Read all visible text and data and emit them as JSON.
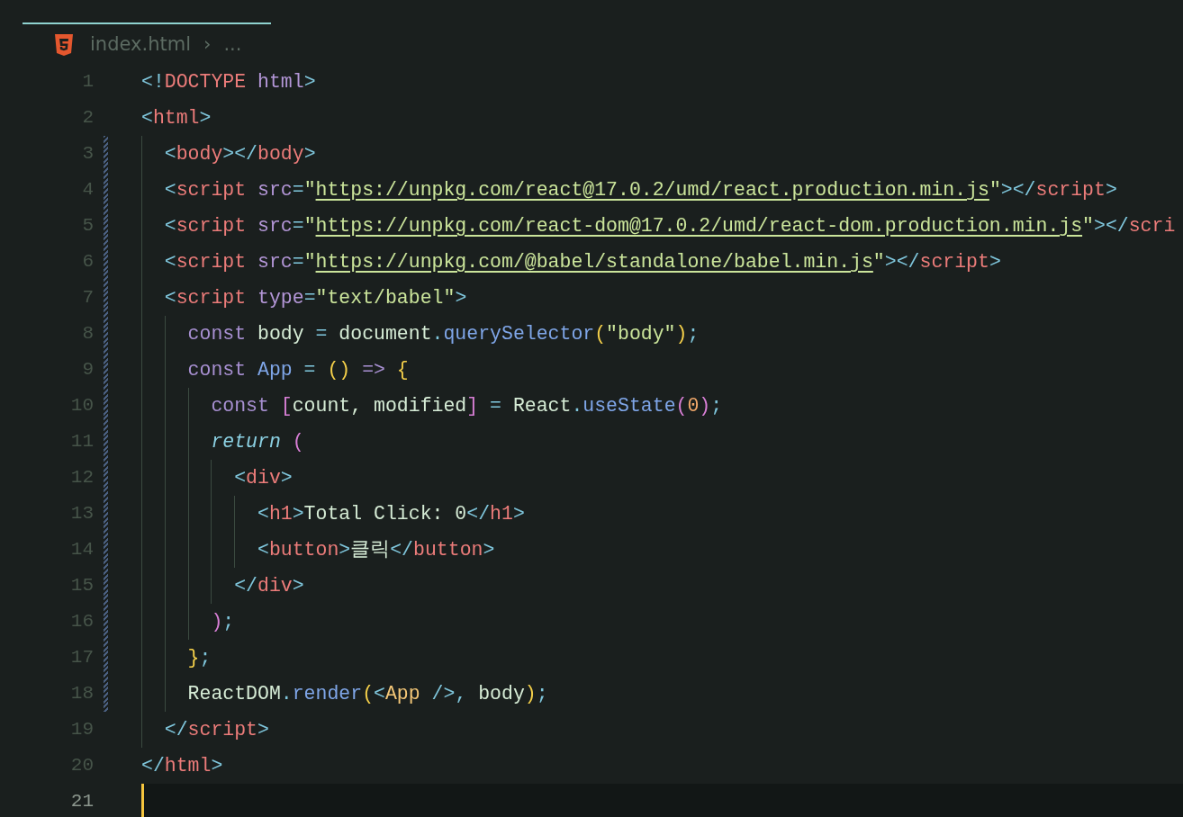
{
  "breadcrumb": {
    "file": "index.html",
    "separator": "›",
    "more": "..."
  },
  "lines": [
    {
      "number": "1",
      "modified": false,
      "current": false,
      "tokens": [
        {
          "kind": "punct",
          "text": "<!"
        },
        {
          "kind": "tag",
          "text": "DOCTYPE"
        },
        {
          "kind": "attr",
          "text": " html"
        },
        {
          "kind": "punct",
          "text": ">"
        }
      ]
    },
    {
      "number": "2",
      "modified": false,
      "current": false,
      "tokens": [
        {
          "kind": "punct",
          "text": "<"
        },
        {
          "kind": "tag",
          "text": "html"
        },
        {
          "kind": "punct",
          "text": ">"
        }
      ]
    },
    {
      "number": "3",
      "modified": true,
      "current": false,
      "tokens": [
        {
          "kind": "punct",
          "text": "  <"
        },
        {
          "kind": "tag",
          "text": "body"
        },
        {
          "kind": "punct",
          "text": "></"
        },
        {
          "kind": "tag",
          "text": "body"
        },
        {
          "kind": "punct",
          "text": ">"
        }
      ]
    },
    {
      "number": "4",
      "modified": true,
      "current": false,
      "tokens": [
        {
          "kind": "punct",
          "text": "  <"
        },
        {
          "kind": "tag",
          "text": "script"
        },
        {
          "kind": "attr",
          "text": " src"
        },
        {
          "kind": "punct",
          "text": "="
        },
        {
          "kind": "string",
          "text": "\""
        },
        {
          "kind": "url",
          "text": "https://unpkg.com/react@17.0.2/umd/react.production.min.js"
        },
        {
          "kind": "string",
          "text": "\""
        },
        {
          "kind": "punct",
          "text": "></"
        },
        {
          "kind": "tag",
          "text": "script"
        },
        {
          "kind": "punct",
          "text": ">"
        }
      ]
    },
    {
      "number": "5",
      "modified": true,
      "current": false,
      "tokens": [
        {
          "kind": "punct",
          "text": "  <"
        },
        {
          "kind": "tag",
          "text": "script"
        },
        {
          "kind": "attr",
          "text": " src"
        },
        {
          "kind": "punct",
          "text": "="
        },
        {
          "kind": "string",
          "text": "\""
        },
        {
          "kind": "url",
          "text": "https://unpkg.com/react-dom@17.0.2/umd/react-dom.production.min.js"
        },
        {
          "kind": "string",
          "text": "\""
        },
        {
          "kind": "punct",
          "text": "></"
        },
        {
          "kind": "tag",
          "text": "scri"
        }
      ]
    },
    {
      "number": "6",
      "modified": true,
      "current": false,
      "tokens": [
        {
          "kind": "punct",
          "text": "  <"
        },
        {
          "kind": "tag",
          "text": "script"
        },
        {
          "kind": "attr",
          "text": " src"
        },
        {
          "kind": "punct",
          "text": "="
        },
        {
          "kind": "string",
          "text": "\""
        },
        {
          "kind": "url",
          "text": "https://unpkg.com/@babel/standalone/babel.min.js"
        },
        {
          "kind": "string",
          "text": "\""
        },
        {
          "kind": "punct",
          "text": "></"
        },
        {
          "kind": "tag",
          "text": "script"
        },
        {
          "kind": "punct",
          "text": ">"
        }
      ]
    },
    {
      "number": "7",
      "modified": true,
      "current": false,
      "tokens": [
        {
          "kind": "punct",
          "text": "  <"
        },
        {
          "kind": "tag",
          "text": "script"
        },
        {
          "kind": "attr",
          "text": " type"
        },
        {
          "kind": "punct",
          "text": "="
        },
        {
          "kind": "string",
          "text": "\"text/babel\""
        },
        {
          "kind": "punct",
          "text": ">"
        }
      ]
    },
    {
      "number": "8",
      "modified": true,
      "current": false,
      "tokens": [
        {
          "kind": "keyword",
          "text": "    const"
        },
        {
          "kind": "var",
          "text": " body"
        },
        {
          "kind": "punct",
          "text": " ="
        },
        {
          "kind": "var",
          "text": " document"
        },
        {
          "kind": "punct",
          "text": "."
        },
        {
          "kind": "func",
          "text": "querySelector"
        },
        {
          "kind": "brace",
          "text": "("
        },
        {
          "kind": "string",
          "text": "\"body\""
        },
        {
          "kind": "brace",
          "text": ")"
        },
        {
          "kind": "punct",
          "text": ";"
        }
      ]
    },
    {
      "number": "9",
      "modified": true,
      "current": false,
      "tokens": [
        {
          "kind": "keyword",
          "text": "    const"
        },
        {
          "kind": "func",
          "text": " App"
        },
        {
          "kind": "punct",
          "text": " ="
        },
        {
          "kind": "brace",
          "text": " ()"
        },
        {
          "kind": "keyword",
          "text": " =>"
        },
        {
          "kind": "brace",
          "text": " {"
        }
      ]
    },
    {
      "number": "10",
      "modified": true,
      "current": false,
      "tokens": [
        {
          "kind": "keyword",
          "text": "      const"
        },
        {
          "kind": "bracket",
          "text": " ["
        },
        {
          "kind": "var",
          "text": "count, modified"
        },
        {
          "kind": "bracket",
          "text": "]"
        },
        {
          "kind": "punct",
          "text": " ="
        },
        {
          "kind": "var",
          "text": " React"
        },
        {
          "kind": "punct",
          "text": "."
        },
        {
          "kind": "func",
          "text": "useState"
        },
        {
          "kind": "bracket",
          "text": "("
        },
        {
          "kind": "number",
          "text": "0"
        },
        {
          "kind": "bracket",
          "text": ")"
        },
        {
          "kind": "punct",
          "text": ";"
        }
      ]
    },
    {
      "number": "11",
      "modified": true,
      "current": false,
      "tokens": [
        {
          "kind": "control",
          "text": "      return"
        },
        {
          "kind": "bracket",
          "text": " ("
        }
      ]
    },
    {
      "number": "12",
      "modified": true,
      "current": false,
      "tokens": [
        {
          "kind": "punct",
          "text": "        <"
        },
        {
          "kind": "tag",
          "text": "div"
        },
        {
          "kind": "punct",
          "text": ">"
        }
      ]
    },
    {
      "number": "13",
      "modified": true,
      "current": false,
      "tokens": [
        {
          "kind": "punct",
          "text": "          <"
        },
        {
          "kind": "tag",
          "text": "h1"
        },
        {
          "kind": "punct",
          "text": ">"
        },
        {
          "kind": "var",
          "text": "Total Click: 0"
        },
        {
          "kind": "punct",
          "text": "</"
        },
        {
          "kind": "tag",
          "text": "h1"
        },
        {
          "kind": "punct",
          "text": ">"
        }
      ]
    },
    {
      "number": "14",
      "modified": true,
      "current": false,
      "tokens": [
        {
          "kind": "punct",
          "text": "          <"
        },
        {
          "kind": "tag",
          "text": "button"
        },
        {
          "kind": "punct",
          "text": ">"
        },
        {
          "kind": "var",
          "text": "클릭"
        },
        {
          "kind": "punct",
          "text": "</"
        },
        {
          "kind": "tag",
          "text": "button"
        },
        {
          "kind": "punct",
          "text": ">"
        }
      ]
    },
    {
      "number": "15",
      "modified": true,
      "current": false,
      "tokens": [
        {
          "kind": "punct",
          "text": "        </"
        },
        {
          "kind": "tag",
          "text": "div"
        },
        {
          "kind": "punct",
          "text": ">"
        }
      ]
    },
    {
      "number": "16",
      "modified": true,
      "current": false,
      "tokens": [
        {
          "kind": "bracket",
          "text": "      )"
        },
        {
          "kind": "punct",
          "text": ";"
        }
      ]
    },
    {
      "number": "17",
      "modified": true,
      "current": false,
      "tokens": [
        {
          "kind": "brace",
          "text": "    }"
        },
        {
          "kind": "punct",
          "text": ";"
        }
      ]
    },
    {
      "number": "18",
      "modified": true,
      "current": false,
      "tokens": [
        {
          "kind": "var",
          "text": "    ReactDOM"
        },
        {
          "kind": "punct",
          "text": "."
        },
        {
          "kind": "func",
          "text": "render"
        },
        {
          "kind": "brace",
          "text": "("
        },
        {
          "kind": "punct",
          "text": "<"
        },
        {
          "kind": "component",
          "text": "App"
        },
        {
          "kind": "punct",
          "text": " />,"
        },
        {
          "kind": "var",
          "text": " body"
        },
        {
          "kind": "brace",
          "text": ")"
        },
        {
          "kind": "punct",
          "text": ";"
        }
      ]
    },
    {
      "number": "19",
      "modified": false,
      "current": false,
      "tokens": [
        {
          "kind": "punct",
          "text": "  </"
        },
        {
          "kind": "tag",
          "text": "script"
        },
        {
          "kind": "punct",
          "text": ">"
        }
      ]
    },
    {
      "number": "20",
      "modified": false,
      "current": false,
      "tokens": [
        {
          "kind": "punct",
          "text": "</"
        },
        {
          "kind": "tag",
          "text": "html"
        },
        {
          "kind": "punct",
          "text": ">"
        }
      ]
    },
    {
      "number": "21",
      "modified": false,
      "current": true
    }
  ]
}
